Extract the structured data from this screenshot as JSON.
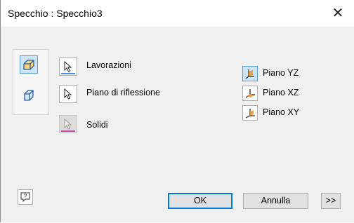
{
  "dialog": {
    "title": "Specchio : Specchio3",
    "close_glyph": "✕"
  },
  "mode": {
    "items": [
      {
        "icon": "solid-mirror-mode-icon",
        "selected": true
      },
      {
        "icon": "features-mirror-mode-icon",
        "selected": false
      }
    ]
  },
  "selectors": [
    {
      "label": "Lavorazioni",
      "underline_color": "#4a8fdc",
      "enabled": true
    },
    {
      "label": "Piano di riflessione",
      "underline_color": null,
      "enabled": true
    },
    {
      "label": "Solidi",
      "underline_color": "#c64fa6",
      "enabled": false
    }
  ],
  "planes": [
    {
      "label": "Piano YZ",
      "selected": true
    },
    {
      "label": "Piano XZ",
      "selected": false
    },
    {
      "label": "Piano XY",
      "selected": false
    }
  ],
  "footer": {
    "help_icon": "help-icon",
    "ok_label": "OK",
    "cancel_label": "Annulla",
    "more_label": ">>"
  },
  "colors": {
    "selection_blue": "#0078d7",
    "selected_fill": "#cde6f7",
    "axis_orange": "#e8932c"
  }
}
